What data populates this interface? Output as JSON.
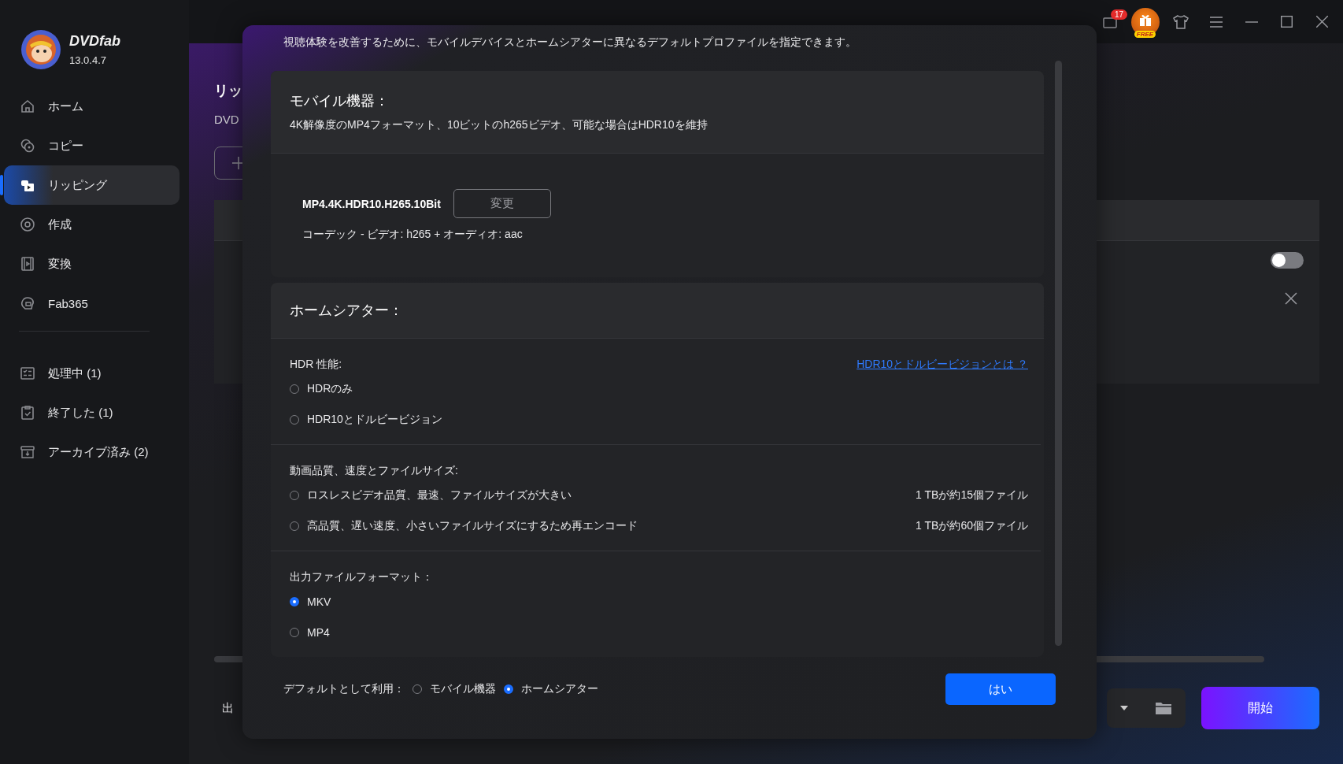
{
  "app": {
    "name": "DVDfab",
    "version": "13.0.4.7"
  },
  "title_bar": {
    "notification_count": "17",
    "promo_label": "FREE"
  },
  "sidebar": {
    "nav": [
      {
        "label": "ホーム",
        "selected": false
      },
      {
        "label": "コピー",
        "selected": false
      },
      {
        "label": "リッピング",
        "selected": true
      },
      {
        "label": "作成",
        "selected": false
      },
      {
        "label": "変換",
        "selected": false
      },
      {
        "label": "Fab365",
        "selected": false
      }
    ],
    "queues": [
      {
        "label": "処理中 (1)"
      },
      {
        "label": "終了した (1)"
      },
      {
        "label": "アーカイブ済み (2)"
      }
    ]
  },
  "page": {
    "title": "リッ",
    "subtitle": "DVD",
    "row_toggle": {
      "on": false
    },
    "output_label": "出",
    "start_button": "開始"
  },
  "dialog": {
    "intro": "視聴体験を改善するために、モバイルデバイスとホームシアターに異なるデフォルトプロファイルを指定できます。",
    "mobile": {
      "title": "モバイル機器：",
      "description": "4K解像度のMP4フォーマット、10ビットのh265ビデオ、可能な場合はHDR10を維持",
      "profile": "MP4.4K.HDR10.H265.10Bit",
      "change_button": "変更",
      "codec": "コーデック - ビデオ: h265 + オーディオ: aac"
    },
    "home_theater": {
      "title": "ホームシアター：",
      "sections": [
        {
          "label": "HDR 性能:",
          "link": "HDR10とドルビービジョンとは ？",
          "options": [
            {
              "label": "HDRのみ",
              "selected": false
            },
            {
              "label": "HDR10とドルビービジョン",
              "selected": false
            }
          ]
        },
        {
          "label": "動画品質、速度とファイルサイズ:",
          "options": [
            {
              "label": "ロスレスビデオ品質、最速、ファイルサイズが大きい",
              "note": "1 TBが約15個ファイル",
              "selected": false
            },
            {
              "label": "高品質、遅い速度、小さいファイルサイズにするため再エンコード",
              "note": "1 TBが約60個ファイル",
              "selected": false
            }
          ]
        },
        {
          "label": "出力ファイルフォーマット：",
          "options": [
            {
              "label": "MKV",
              "selected": true
            },
            {
              "label": "MP4",
              "selected": false
            }
          ]
        }
      ]
    },
    "default_use": {
      "label": "デフォルトとして利用：",
      "options": [
        {
          "label": "モバイル機器",
          "selected": false
        },
        {
          "label": "ホームシアター",
          "selected": true
        }
      ]
    },
    "confirm_button": "はい"
  }
}
